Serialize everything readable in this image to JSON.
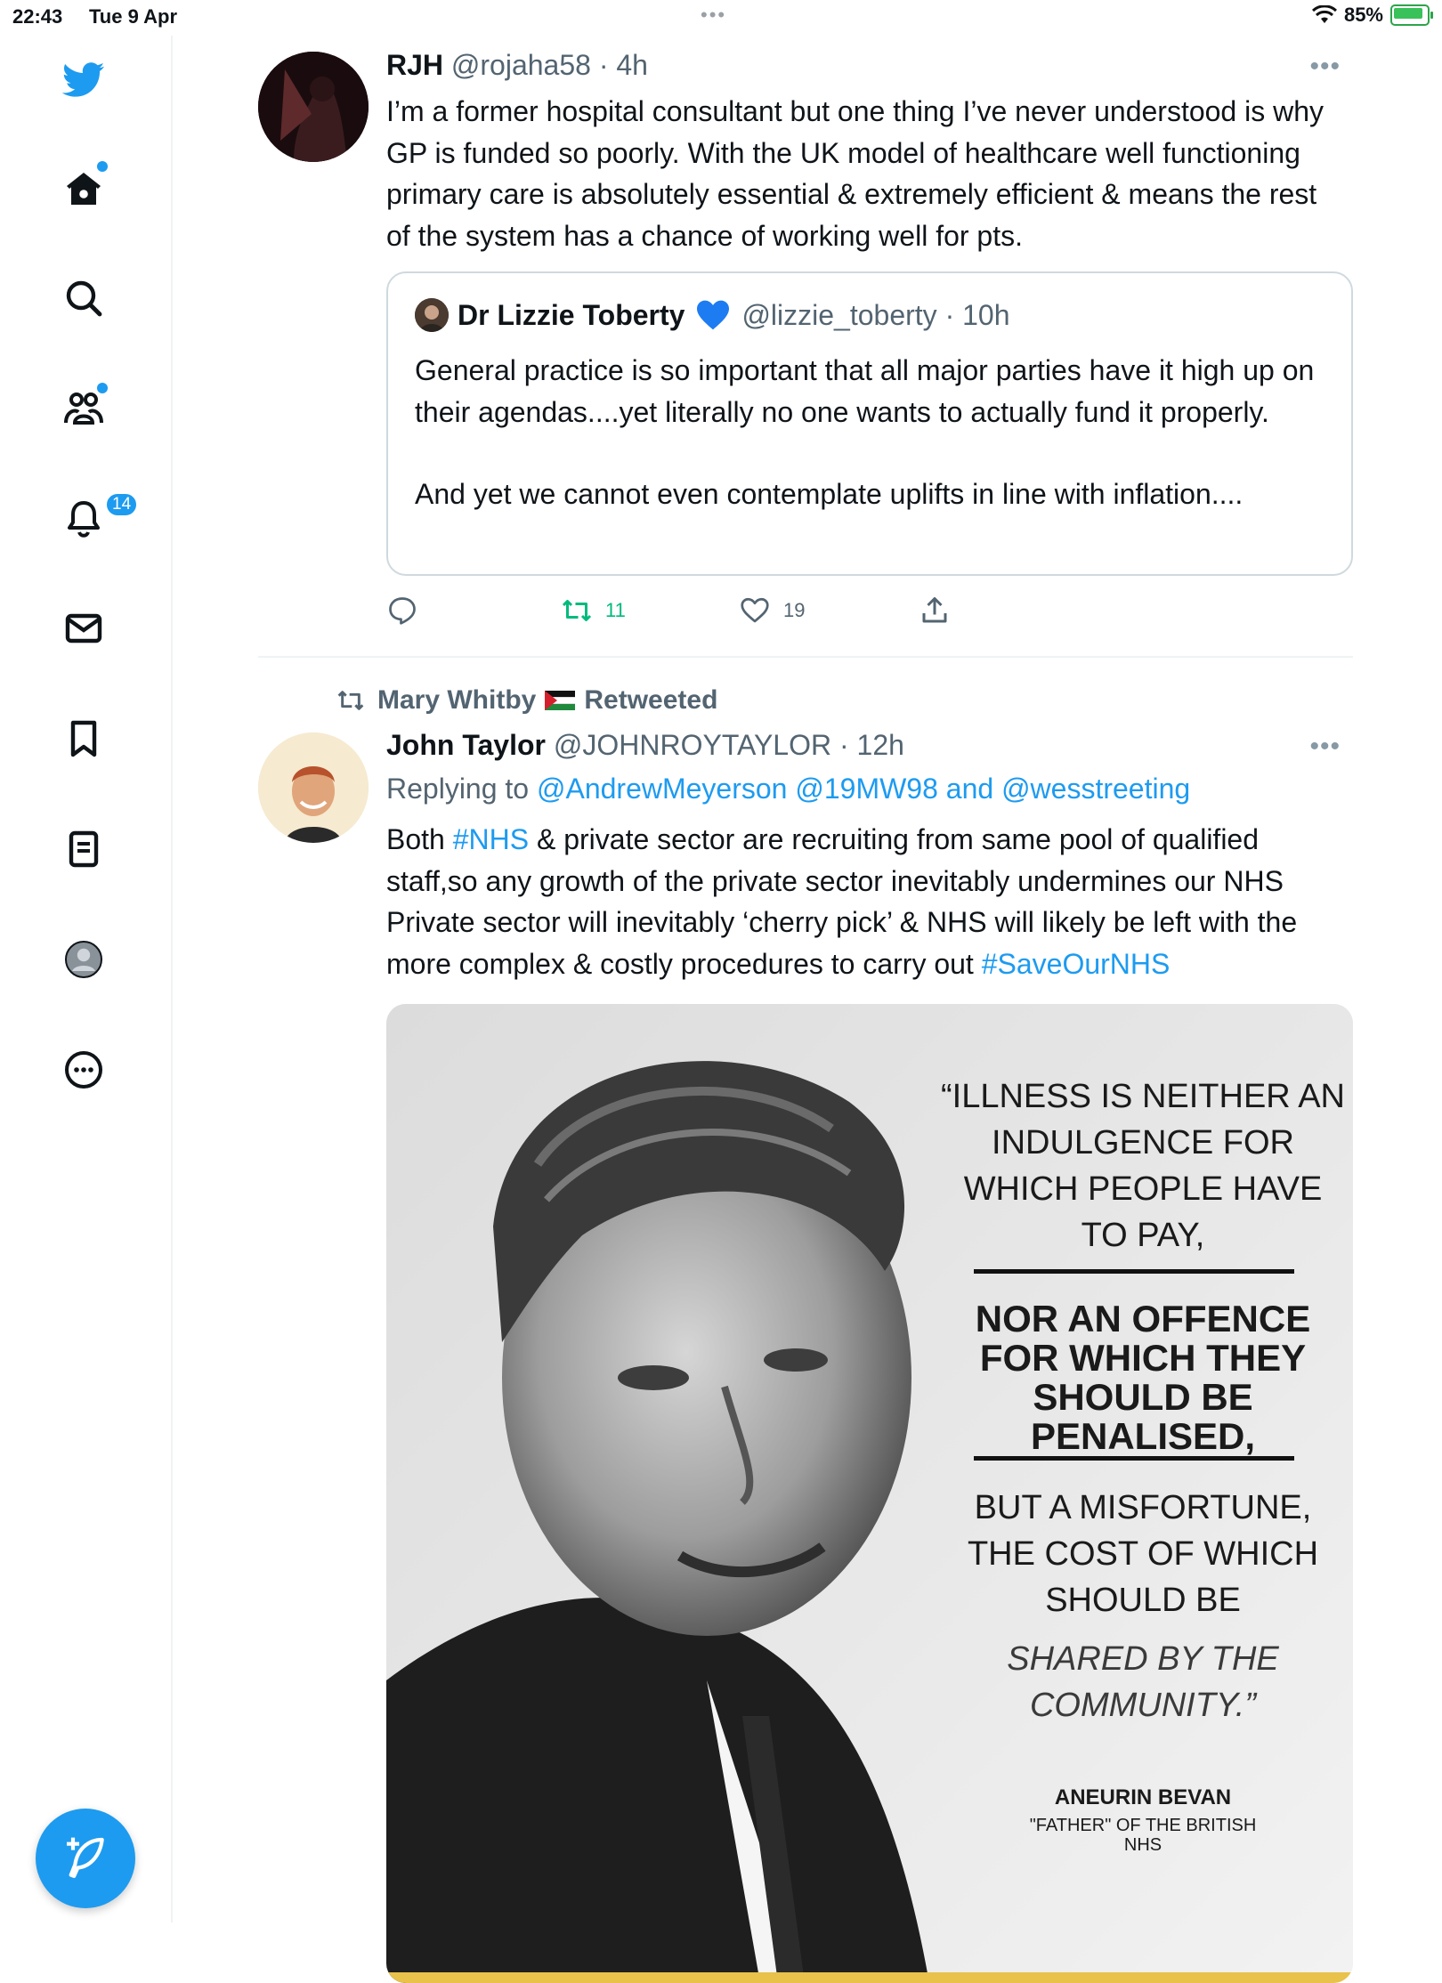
{
  "status_bar": {
    "time": "22:43",
    "date": "Tue 9 Apr",
    "battery": "85%"
  },
  "sidebar": {
    "notifications_badge": "14"
  },
  "tweet1": {
    "name": "RJH",
    "handle": "@rojaha58",
    "time": "4h",
    "text": "I’m a former hospital consultant but one thing I’ve never understood is why GP is funded so poorly. With the UK model of healthcare well functioning primary care is absolutely essential & extremely efficient & means the rest of the system has a chance of working well for pts.",
    "quote": {
      "name": "Dr Lizzie Toberty",
      "handle": "@lizzie_toberty",
      "time": "10h",
      "text1": "General practice is so important that all major parties have it high up on their agendas....yet literally no one wants to actually fund it properly.",
      "text2": "And yet we cannot even contemplate uplifts in line with inflation...."
    },
    "retweets": "11",
    "likes": "19"
  },
  "tweet2": {
    "retweeted_by": "Mary Whitby",
    "retweeted_label": "Retweeted",
    "name": "John Taylor",
    "handle": "@JOHNROYTAYLOR",
    "time": "12h",
    "replying_prefix": "Replying to",
    "replying_to": "@AndrewMeyerson @19MW98 and @wesstreeting",
    "text_part1": "Both",
    "hashtag1": "#NHS",
    "text_part2": "& private sector are recruiting from same pool of qualified staff,so any growth of the private sector inevitably undermines our NHS Private sector will inevitably ‘cherry pick’ & NHS will likely be left with the more complex & costly procedures to carry out",
    "hashtag2": "#SaveOurNHS",
    "image": {
      "quote1": "“ILLNESS IS NEITHER AN INDULGENCE FOR WHICH PEOPLE HAVE TO PAY,",
      "quote2": "NOR AN OFFENCE FOR WHICH THEY SHOULD BE PENALISED,",
      "quote3": "BUT A MISFORTUNE, THE COST OF WHICH SHOULD BE",
      "quote4": "SHARED BY THE COMMUNITY.”",
      "author": "ANEURIN BEVAN",
      "author_title": "\"FATHER\" OF THE BRITISH NHS"
    }
  },
  "colors": {
    "accent": "#1d9bf0",
    "retweet": "#00ba7c",
    "muted": "#536471"
  }
}
